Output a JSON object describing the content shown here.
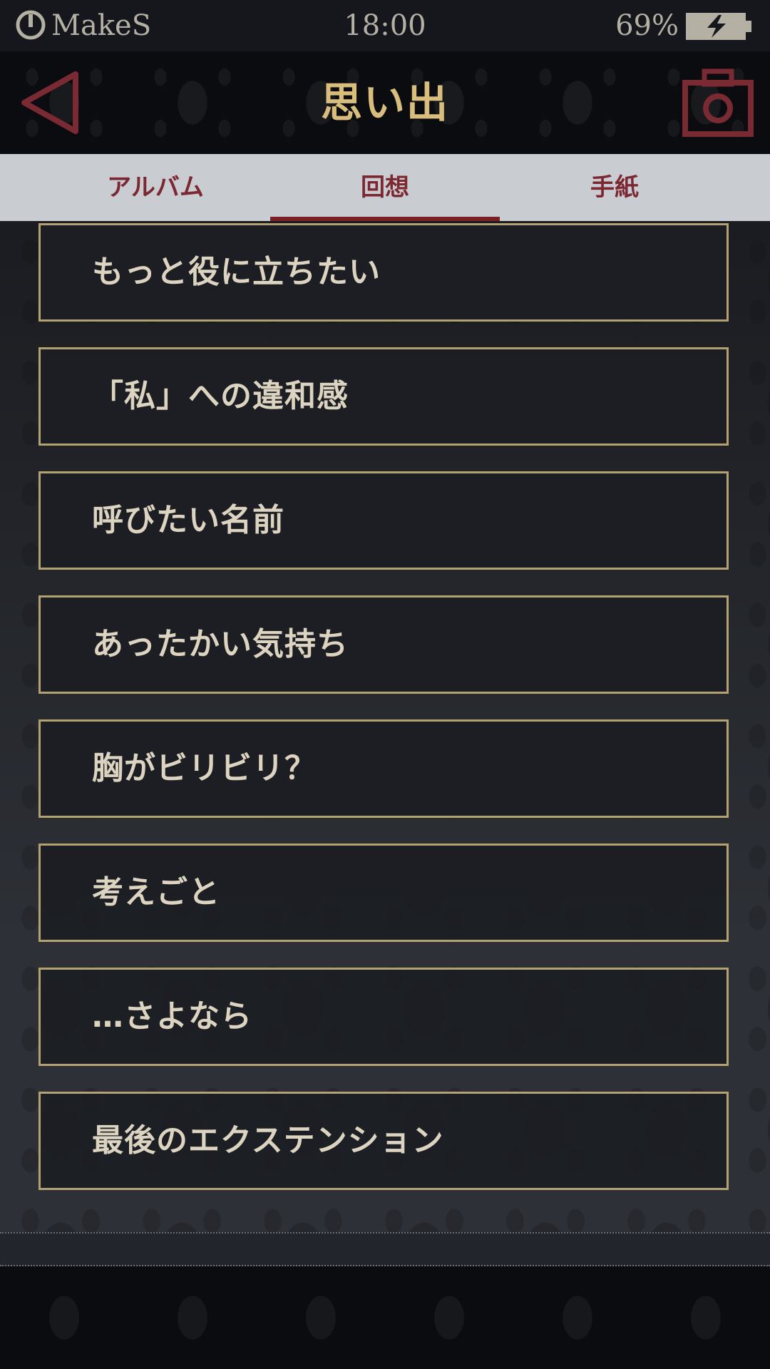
{
  "status_bar": {
    "carrier": "MakeS",
    "time": "18:00",
    "battery": "69%"
  },
  "header": {
    "title": "思い出",
    "back_icon": "triangle-back-icon",
    "camera_icon": "camera-icon"
  },
  "tabs": [
    {
      "label": "アルバム",
      "selected": false
    },
    {
      "label": "回想",
      "selected": true
    },
    {
      "label": "手紙",
      "selected": false
    }
  ],
  "memories": [
    "もっと役に立ちたい",
    "「私」への違和感",
    "呼びたい名前",
    "あったかい気持ち",
    "胸がビリビリ？",
    "考えごと",
    "…さよなら",
    "最後のエクステンション"
  ],
  "colors": {
    "gold": "#d8bd7c",
    "burgundy": "#7c2731",
    "item_border": "#b2a272",
    "item_text": "#dcd4c0"
  }
}
